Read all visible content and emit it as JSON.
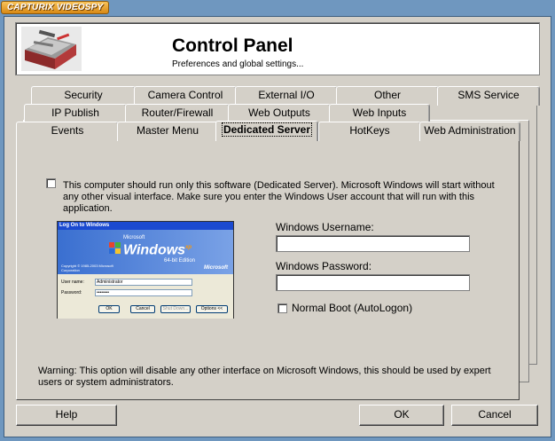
{
  "app": {
    "badge": "CAPTURIX VIDEOSPY"
  },
  "header": {
    "title": "Control Panel",
    "subtitle": "Preferences and global settings..."
  },
  "tabs": {
    "row1": [
      "Security",
      "Camera Control",
      "External I/O",
      "Other",
      "SMS Service"
    ],
    "row2": [
      "IP Publish",
      "Router/Firewall",
      "Web Outputs",
      "Web Inputs"
    ],
    "row3": [
      "Events",
      "Master Menu",
      "Dedicated Server",
      "HotKeys",
      "Web Administration"
    ],
    "active": "Dedicated Server"
  },
  "panel": {
    "description": "This computer should run only this software (Dedicated Server). Microsoft Windows will start without any other visual interface. Make sure you enter the Windows User account that will run with this application.",
    "dedicated_checked": false,
    "preview": {
      "title": "Log On to Windows",
      "brand_small": "Microsoft",
      "brand": "Windows",
      "brand_xp": "xp",
      "edition": "64-bit Edition",
      "copyright": "Copyright © 1985-2003 Microsoft Corporation",
      "ms": "Microsoft",
      "user_label": "User name:",
      "user_value": "Administrator",
      "pass_label": "Password:",
      "pass_value": "••••••••",
      "ok": "OK",
      "cancel": "Cancel",
      "shutdown": "Shut Down...",
      "options": "Options <<"
    },
    "username_label": "Windows Username:",
    "username_value": "",
    "password_label": "Windows Password:",
    "password_value": "",
    "normal_boot_label": "Normal Boot (AutoLogon)",
    "normal_boot_checked": false,
    "warning": "Warning: This option will disable any other interface on Microsoft Windows, this should be used by expert users or system administrators."
  },
  "buttons": {
    "help": "Help",
    "ok": "OK",
    "cancel": "Cancel"
  },
  "colors": {
    "desktop": "#6f97bf",
    "face": "#d4d0c8",
    "badge": "#e8a128"
  },
  "icons": {
    "header": "toolbox-icon"
  }
}
